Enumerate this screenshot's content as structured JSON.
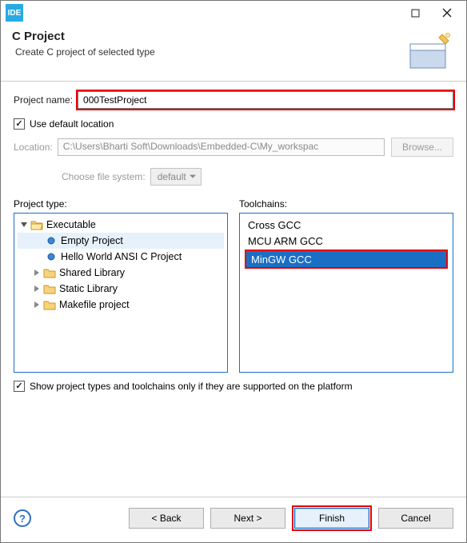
{
  "titlebar": {
    "app_badge": "IDE"
  },
  "banner": {
    "title": "C Project",
    "subtitle": "Create C project of selected type"
  },
  "fields": {
    "project_name_label": "Project name:",
    "project_name_value": "000TestProject",
    "use_default_location_label": "Use default location",
    "location_label": "Location:",
    "location_value": "C:\\Users\\Bharti Soft\\Downloads\\Embedded-C\\My_workspac",
    "browse_label": "Browse...",
    "choose_fs_label": "Choose file system:",
    "fs_value": "default"
  },
  "project_type": {
    "label": "Project type:",
    "executable": "Executable",
    "empty": "Empty Project",
    "hello": "Hello World ANSI C Project",
    "shared": "Shared Library",
    "static": "Static Library",
    "makefile": "Makefile project"
  },
  "toolchains": {
    "label": "Toolchains:",
    "items": [
      "Cross GCC",
      "MCU ARM GCC",
      "MinGW GCC"
    ]
  },
  "filter_label": "Show project types and toolchains only if they are supported on the platform",
  "buttons": {
    "back": "< Back",
    "next": "Next >",
    "finish": "Finish",
    "cancel": "Cancel"
  }
}
